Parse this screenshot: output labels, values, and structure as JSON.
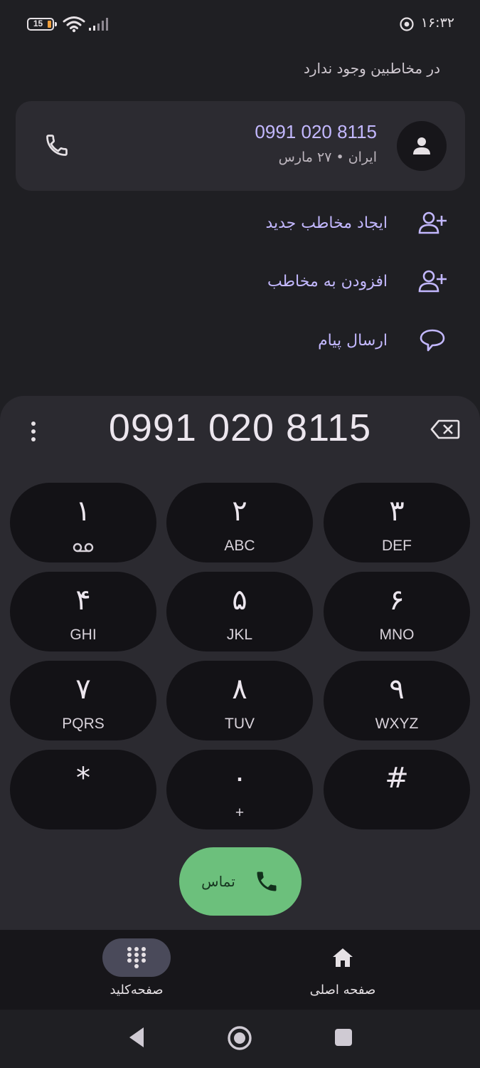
{
  "status_bar": {
    "battery_level": "15",
    "time": "۱۶:۳۲"
  },
  "search_status": "در مخاطبین وجود ندارد",
  "result": {
    "number": "0991 020 8115",
    "subtitle": "ایران • ۲۷ مارس"
  },
  "actions": [
    {
      "label": "ایجاد مخاطب جدید",
      "icon": "add-person-icon"
    },
    {
      "label": "افزودن به مخاطب",
      "icon": "add-person-icon"
    },
    {
      "label": "ارسال پیام",
      "icon": "message-icon"
    }
  ],
  "dialer": {
    "entered_number": "0991 020 8115",
    "keys": [
      {
        "digit": "۱",
        "letters": ""
      },
      {
        "digit": "۲",
        "letters": "ABC"
      },
      {
        "digit": "۳",
        "letters": "DEF"
      },
      {
        "digit": "۴",
        "letters": "GHI"
      },
      {
        "digit": "۵",
        "letters": "JKL"
      },
      {
        "digit": "۶",
        "letters": "MNO"
      },
      {
        "digit": "۷",
        "letters": "PQRS"
      },
      {
        "digit": "۸",
        "letters": "TUV"
      },
      {
        "digit": "۹",
        "letters": "WXYZ"
      },
      {
        "digit": "*",
        "letters": ""
      },
      {
        "digit": "۰",
        "letters": "+"
      },
      {
        "digit": "#",
        "letters": ""
      }
    ],
    "call_label": "تماس"
  },
  "nav": {
    "keypad_label": "صفحه‌کلید",
    "home_label": "صفحه اصلی"
  },
  "colors": {
    "background": "#1f1f23",
    "accent": "#c3b8ff",
    "call_green": "#6cc07c",
    "key_bg": "#131216"
  }
}
